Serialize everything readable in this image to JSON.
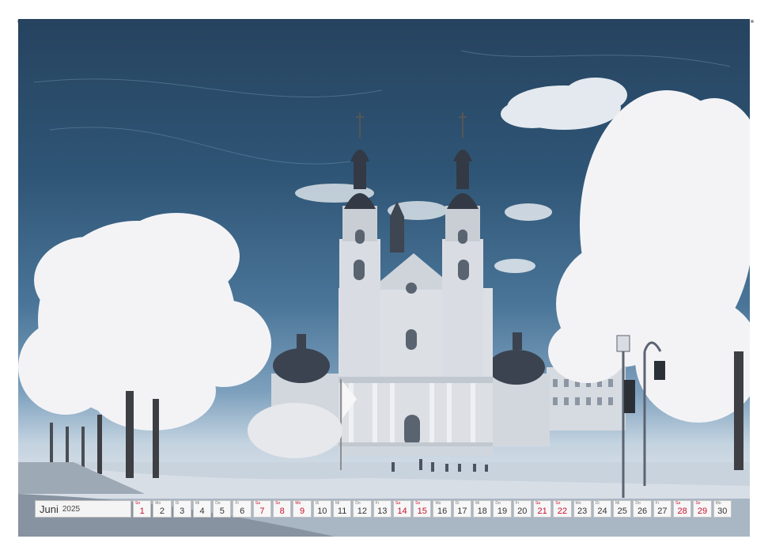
{
  "calendar": {
    "month": "Juni",
    "year": "2025",
    "days": [
      {
        "wd": "So",
        "num": "1",
        "weekend": true
      },
      {
        "wd": "Mo",
        "num": "2",
        "weekend": false
      },
      {
        "wd": "Di",
        "num": "3",
        "weekend": false
      },
      {
        "wd": "Mi",
        "num": "4",
        "weekend": false
      },
      {
        "wd": "Do",
        "num": "5",
        "weekend": false
      },
      {
        "wd": "Fr",
        "num": "6",
        "weekend": false
      },
      {
        "wd": "Sa",
        "num": "7",
        "weekend": true
      },
      {
        "wd": "So",
        "num": "8",
        "weekend": true
      },
      {
        "wd": "Mo",
        "num": "9",
        "weekend": true
      },
      {
        "wd": "Di",
        "num": "10",
        "weekend": false
      },
      {
        "wd": "Mi",
        "num": "11",
        "weekend": false
      },
      {
        "wd": "Do",
        "num": "12",
        "weekend": false
      },
      {
        "wd": "Fr",
        "num": "13",
        "weekend": false
      },
      {
        "wd": "Sa",
        "num": "14",
        "weekend": true
      },
      {
        "wd": "So",
        "num": "15",
        "weekend": true
      },
      {
        "wd": "Mo",
        "num": "16",
        "weekend": false
      },
      {
        "wd": "Di",
        "num": "17",
        "weekend": false
      },
      {
        "wd": "Mi",
        "num": "18",
        "weekend": false
      },
      {
        "wd": "Do",
        "num": "19",
        "weekend": false
      },
      {
        "wd": "Fr",
        "num": "20",
        "weekend": false
      },
      {
        "wd": "Sa",
        "num": "21",
        "weekend": true
      },
      {
        "wd": "So",
        "num": "22",
        "weekend": true
      },
      {
        "wd": "Mo",
        "num": "23",
        "weekend": false
      },
      {
        "wd": "Di",
        "num": "24",
        "weekend": false
      },
      {
        "wd": "Mi",
        "num": "25",
        "weekend": false
      },
      {
        "wd": "Do",
        "num": "26",
        "weekend": false
      },
      {
        "wd": "Fr",
        "num": "27",
        "weekend": false
      },
      {
        "wd": "Sa",
        "num": "28",
        "weekend": true
      },
      {
        "wd": "So",
        "num": "29",
        "weekend": true
      },
      {
        "wd": "Mo",
        "num": "30",
        "weekend": false
      }
    ]
  },
  "colors": {
    "weekend": "#c8102e",
    "sky": "#2f5576",
    "foliage": "#f3f3f6"
  }
}
